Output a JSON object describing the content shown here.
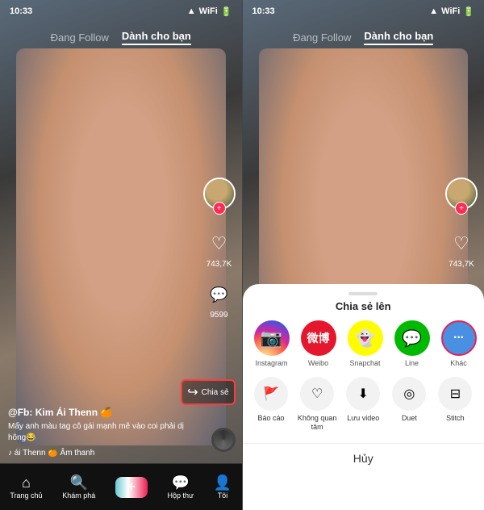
{
  "left_panel": {
    "status": {
      "time": "10:33",
      "icons": "▲ ● WiFi Batt"
    },
    "nav": {
      "tab1": "Đang Follow",
      "tab2": "Dành cho bạn"
    },
    "actions": {
      "likes": "743,7K",
      "comments": "9599"
    },
    "video_info": {
      "user": "@Fb: Kim Ái Thenn 🍊",
      "desc": "Mấy anh màu tag cô gái mạnh mẽ vào coi phải dị hông😂",
      "music": "♪ ái Thenn 🍊 Âm thanh"
    },
    "share_label": "Chia sẻ"
  },
  "right_panel": {
    "status": {
      "time": "10:33"
    },
    "nav": {
      "tab1": "Đang Follow",
      "tab2": "Dành cho bạn"
    },
    "actions": {
      "likes": "743,7K"
    },
    "bottom_sheet": {
      "title": "Chia sẻ lên",
      "apps": [
        {
          "label": "Instagram",
          "color": "#E1306C",
          "icon": "📷"
        },
        {
          "label": "Weibo",
          "color": "#E6162D",
          "icon": "微"
        },
        {
          "label": "Snapchat",
          "color": "#FFFC00",
          "icon": "👻"
        },
        {
          "label": "Line",
          "color": "#00B900",
          "icon": "💬"
        },
        {
          "label": "Khác",
          "color": "#4A90E2",
          "icon": "···"
        }
      ],
      "actions": [
        {
          "label": "Báo cáo",
          "icon": "🚩"
        },
        {
          "label": "Không quan tâm",
          "icon": "♡"
        },
        {
          "label": "Lưu video",
          "icon": "⬇"
        },
        {
          "label": "Duet",
          "icon": "◎"
        },
        {
          "label": "Stitch",
          "icon": "⊟"
        }
      ],
      "cancel": "Hủy"
    }
  },
  "tab_bar": {
    "items": [
      {
        "label": "Trang chủ",
        "icon": "⌂"
      },
      {
        "label": "Khám phá",
        "icon": "🔍"
      },
      {
        "label": "+",
        "icon": "+"
      },
      {
        "label": "Hộp thư",
        "icon": "💬"
      },
      {
        "label": "Tôi",
        "icon": "👤"
      }
    ]
  }
}
